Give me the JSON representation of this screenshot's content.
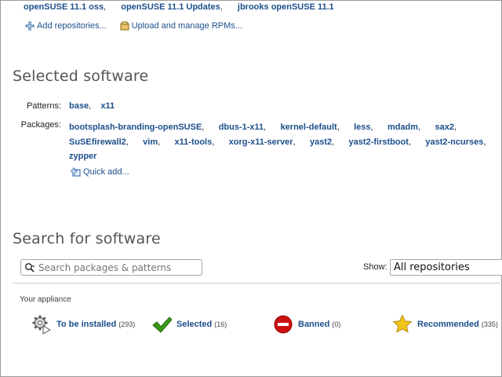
{
  "repositories": [
    {
      "name": "openSUSE 11.1 oss",
      "sep": ","
    },
    {
      "name": "openSUSE 11.1 Updates",
      "sep": ","
    },
    {
      "name": "jbrooks openSUSE 11.1",
      "sep": ""
    }
  ],
  "actions": {
    "add_repositories": "Add repositories...",
    "upload_rpms": "Upload and manage RPMs..."
  },
  "selected_software": {
    "heading": "Selected software",
    "patterns_label": "Patterns:",
    "patterns": [
      "base",
      "x11"
    ],
    "packages_label": "Packages:",
    "packages": [
      "bootsplash-branding-openSUSE",
      "dbus-1-x11",
      "kernel-default",
      "less",
      "mdadm",
      "sax2",
      "SuSEfirewall2",
      "vim",
      "x11-tools",
      "xorg-x11-server",
      "yast2",
      "yast2-firstboot",
      "yast2-ncurses",
      "zypper"
    ],
    "quick_add": "Quick add..."
  },
  "search": {
    "heading": "Search for software",
    "placeholder": "Search packages & patterns",
    "show_label": "Show:",
    "show_value": "All repositories"
  },
  "appliance": {
    "heading": "Your appliance",
    "filters": [
      {
        "label": "To be installed",
        "count": "(293)",
        "icon": "gear-install-icon"
      },
      {
        "label": "Selected",
        "count": "(16)",
        "icon": "checkmark-icon"
      },
      {
        "label": "Banned",
        "count": "(0)",
        "icon": "banned-icon"
      },
      {
        "label": "Recommended",
        "count": "(335)",
        "icon": "star-icon"
      }
    ]
  },
  "colors": {
    "link": "#1c4f8c",
    "check": "#3a9a1a",
    "ban": "#cc1111",
    "star": "#f2c51a"
  }
}
